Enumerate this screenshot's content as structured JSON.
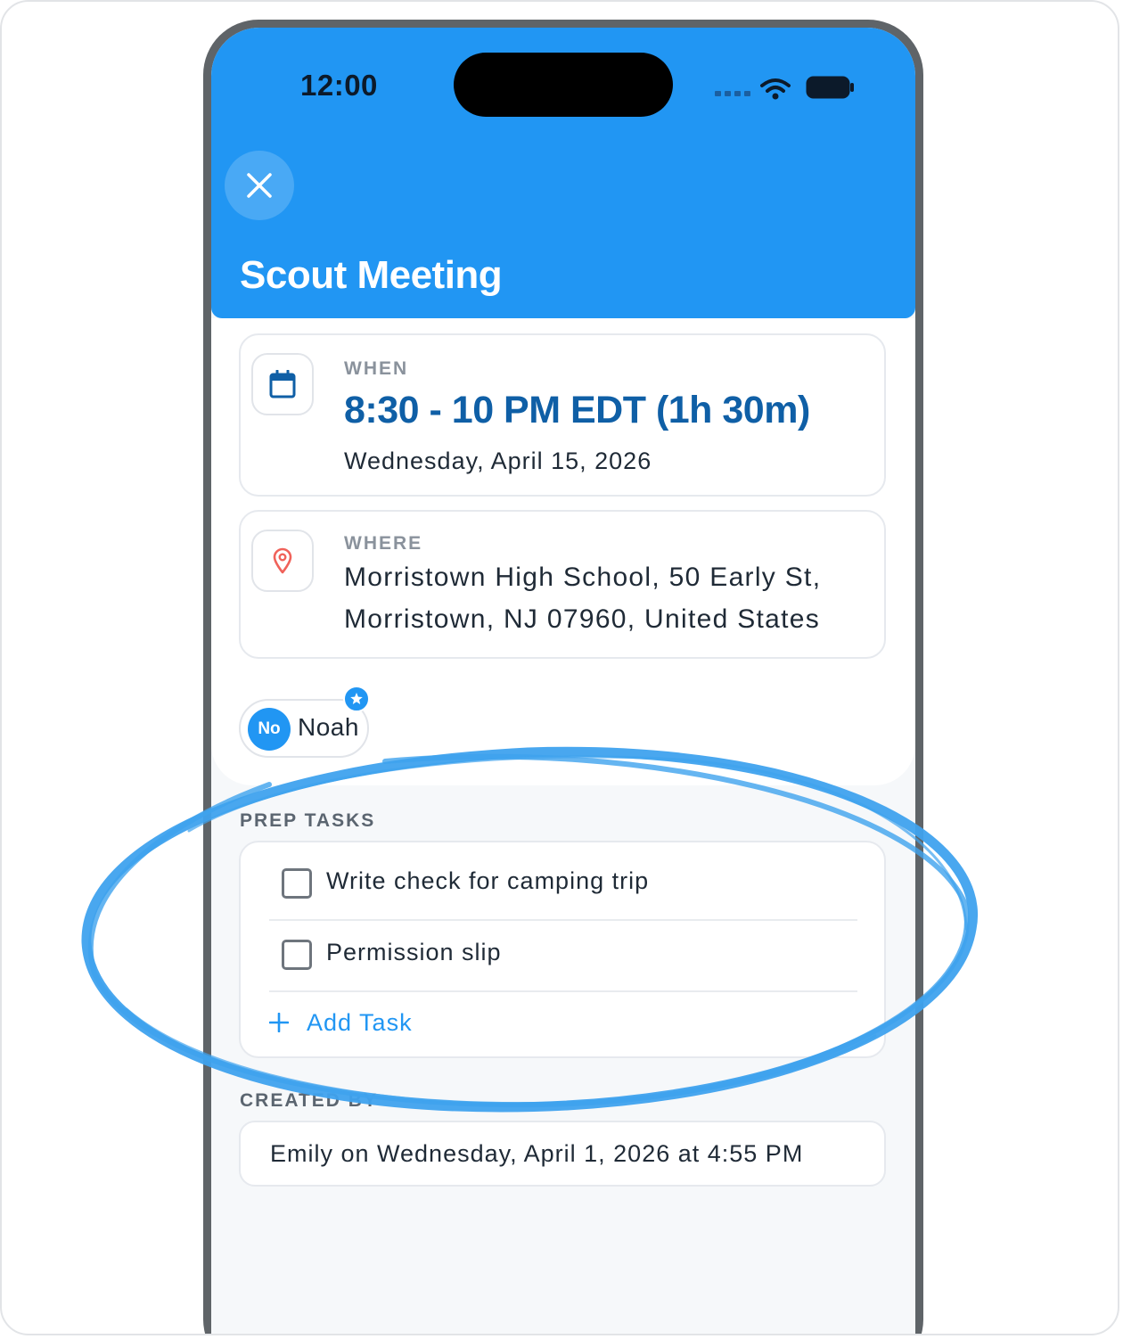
{
  "status_bar": {
    "time": "12:00"
  },
  "header": {
    "title": "Scout Meeting",
    "close_icon": "close-icon"
  },
  "when": {
    "label": "WHEN",
    "time_range": "8:30 - 10 PM EDT (1h 30m)",
    "date": "Wednesday, April 15, 2026",
    "icon": "calendar-icon"
  },
  "where": {
    "label": "WHERE",
    "address_line1": "Morristown High School, 50 Early St,",
    "address_line2": "Morristown, NJ 07960, United States",
    "icon": "map-pin-icon"
  },
  "attendee": {
    "initials": "No",
    "name": "Noah",
    "badge_icon": "star-icon"
  },
  "prep_tasks": {
    "label": "PREP TASKS",
    "items": [
      {
        "text": "Write check for camping trip",
        "checked": false
      },
      {
        "text": "Permission slip",
        "checked": false
      }
    ],
    "add_label": "Add Task"
  },
  "created_by": {
    "label": "CREATED BY",
    "text": "Emily on Wednesday, April 1, 2026 at 4:55 PM"
  },
  "colors": {
    "header_blue": "#2196f3",
    "accent_dark_blue": "#0f5fa6",
    "pin_red": "#f0625a",
    "highlight_ink": "#3fa2ee"
  }
}
